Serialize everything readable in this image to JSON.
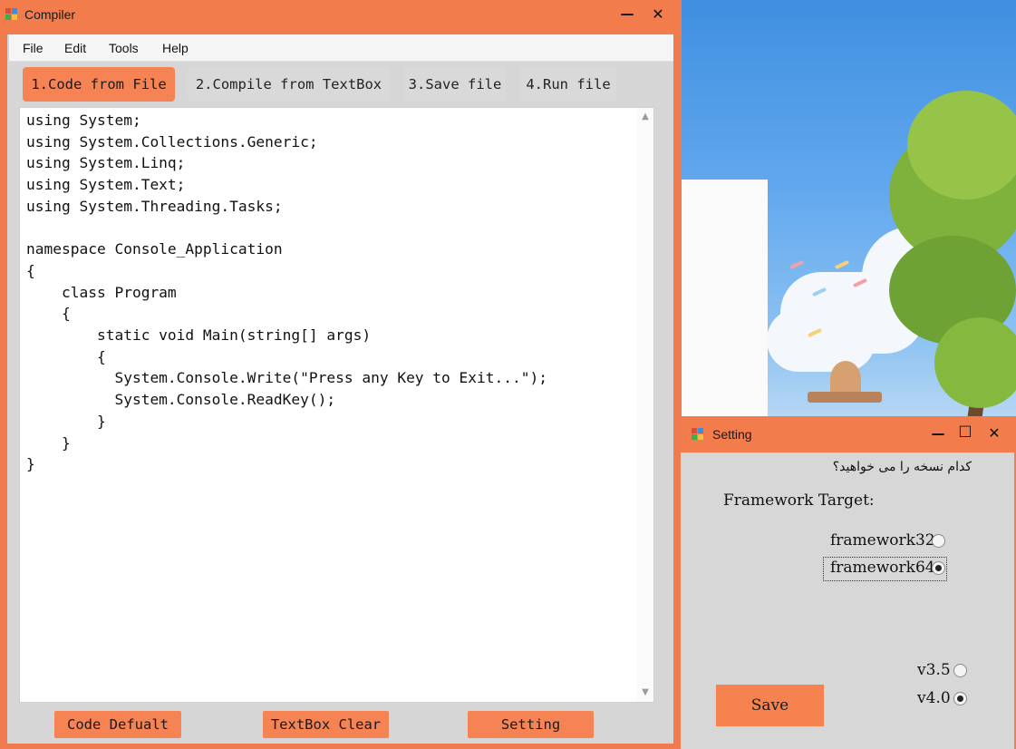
{
  "compiler_window": {
    "title": "Compiler",
    "controls": {
      "minimize": "—",
      "close": "✕"
    },
    "menu": [
      "File",
      "Edit",
      "Tools",
      "Help"
    ],
    "tabs": [
      {
        "label": "1.Code from File",
        "active": true
      },
      {
        "label": "2.Compile from TextBox",
        "active": false
      },
      {
        "label": "3.Save file",
        "active": false
      },
      {
        "label": "4.Run file",
        "active": false
      }
    ],
    "code_lines": [
      "using System;",
      "using System.Collections.Generic;",
      "using System.Linq;",
      "using System.Text;",
      "using System.Threading.Tasks;",
      "",
      "namespace Console_Application",
      "{",
      "    class Program",
      "    {",
      "        static void Main(string[] args)",
      "        {",
      "          System.Console.Write(\"Press any Key to Exit...\");",
      "          System.Console.ReadKey();",
      "        }",
      "    }",
      "}"
    ],
    "scroll": {
      "up_icon": "▲",
      "down_icon": "▼"
    },
    "bottom_buttons": {
      "code_default": "Code Defualt",
      "textbox_clear": "TextBox Clear",
      "setting": "Setting"
    }
  },
  "setting_window": {
    "title": "Setting",
    "controls": {
      "minimize": "—",
      "maximize": "☐",
      "close": "✕"
    },
    "question": "کدام نسخه را می خواهید؟",
    "framework_target_label": "Framework Target:",
    "framework_options": [
      {
        "label": "framework32",
        "selected": false
      },
      {
        "label": "framework64",
        "selected": true
      }
    ],
    "version_options": [
      {
        "label": "v3.5",
        "selected": false
      },
      {
        "label": "v4.0",
        "selected": true
      }
    ],
    "save_label": "Save"
  },
  "colors": {
    "accent": "#f37c4d",
    "button": "#f58354",
    "client_bg": "#d6d6d6"
  }
}
